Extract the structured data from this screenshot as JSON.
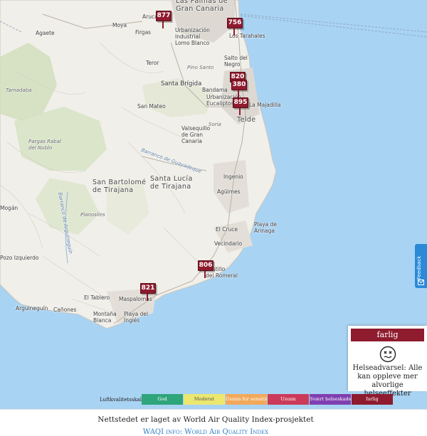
{
  "map": {
    "places": [
      "Las Palmas de\nGran Canaria",
      "Arucas",
      "Moya",
      "Firgas",
      "Agaete",
      "Urbanización\nIndustrial\nLomo Blanco",
      "Los Tarahales",
      "Teror",
      "Salto del\nNegro",
      "Pino Santo",
      "Santa Brígida",
      "Tamadaba",
      "Bandama",
      "San Mateo",
      "Urbanización\nEucaliptos",
      "La Majadilla",
      "Telde",
      "Valsequillo\nde Gran\nCanaria",
      "Pargas Rabal\ndel Nublo",
      "Santa Lucía\nde Tirajana",
      "San Bartolomé\nde Tirajana",
      "Ingenio",
      "Agüimes",
      "Mogán",
      "Playa de\nArinaga",
      "El Cruce",
      "Vecindario",
      "Pozo Izquierdo",
      "Castillo\ndel Romeral",
      "El Tablero",
      "Maspalomas",
      "Arguineguín",
      "Cañones",
      "Montaña\nBlanca",
      "Playa del\nInglés",
      "Barranco de Guayadeque",
      "Barranco de Arguineguín",
      "Planosiles",
      "Soria"
    ],
    "stations": [
      "877",
      "756",
      "820",
      "380",
      "895",
      "806",
      "821"
    ]
  },
  "panel": {
    "level": "farlig",
    "face_icon": "hazardous-face-icon",
    "warning": "Helseadvarsel: Alle kan oppleve mer alvorlige helseeffekter"
  },
  "scale": {
    "title": "Luftkvalitetsskala",
    "levels": [
      {
        "label": "God",
        "color": "#2ea57a"
      },
      {
        "label": "Moderat",
        "color": "#ece76f"
      },
      {
        "label": "Usunn for sensitive grupper",
        "color": "#f2a85b"
      },
      {
        "label": "Usunn",
        "color": "#cc3a5a"
      },
      {
        "label": "Svært helseskadelig",
        "color": "#7f3fb0"
      },
      {
        "label": "farlig",
        "color": "#8e1b2e"
      }
    ]
  },
  "feedback": {
    "label": "Feedback"
  },
  "footer": {
    "line1": "Nettstedet er laget av World Air Quality Index-prosjektet",
    "line2": "WAQI info: World Air Quality Index"
  }
}
